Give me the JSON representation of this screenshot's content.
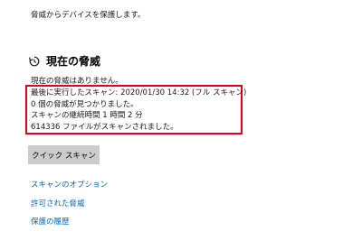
{
  "intro_text": "脅威からデバイスを保護します。",
  "current_threats": {
    "icon": "clock-refresh-icon",
    "title": "現在の脅威",
    "no_threats": "現在の脅威はありません。",
    "highlight_color": "#e0001b",
    "lines": [
      "最後に実行したスキャン: 2020/01/30 14:32 (フル スキャン)",
      "0 個の脅威が見つかりました。",
      "スキャンの継続時間 1 時間 2 分",
      "614336 ファイルがスキャンされました。"
    ]
  },
  "quick_scan_button": "クイック スキャン",
  "links": [
    "スキャンのオプション",
    "許可された脅威",
    "保護の履歴"
  ],
  "link_color": "#0067b8"
}
